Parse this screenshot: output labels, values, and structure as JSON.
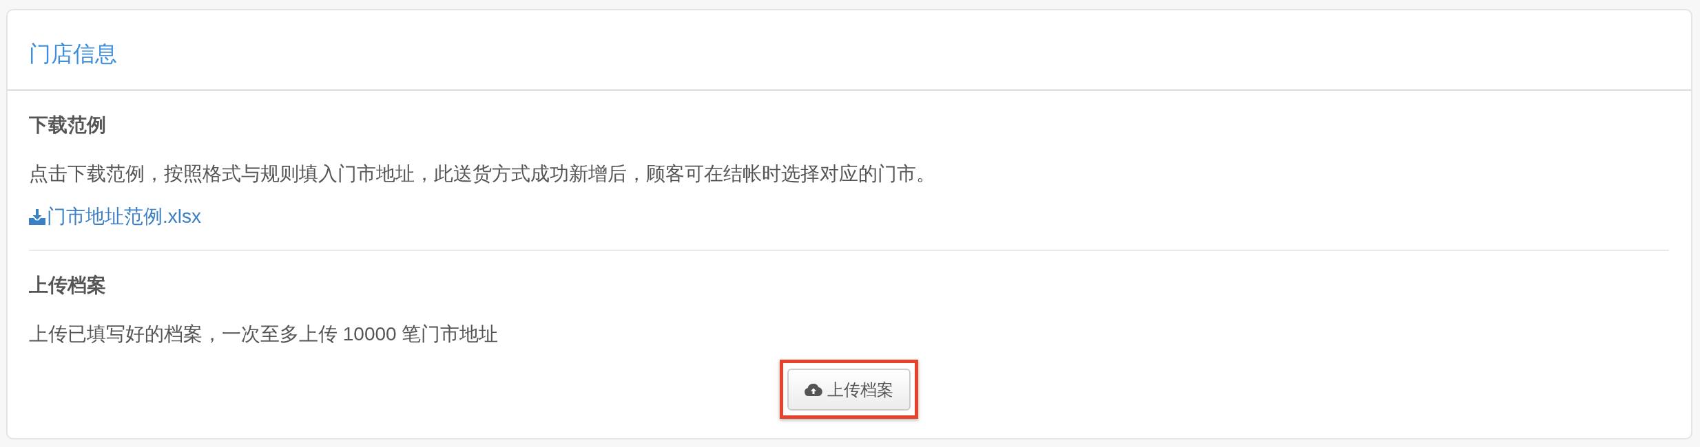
{
  "panel": {
    "title": "门店信息"
  },
  "sections": [
    {
      "kind": "download",
      "heading": "下载范例",
      "description": "点击下载范例，按照格式与规则填入门市地址，此送货方式成功新增后，顾客可在结帐时选择对应的门市。",
      "link": {
        "label": "门市地址范例.xlsx"
      }
    },
    {
      "kind": "upload",
      "heading": "上传档案",
      "description": "上传已填写好的档案，一次至多上传 10000 笔门市地址",
      "button": {
        "label": "上传档案",
        "highlighted": true
      }
    }
  ]
}
